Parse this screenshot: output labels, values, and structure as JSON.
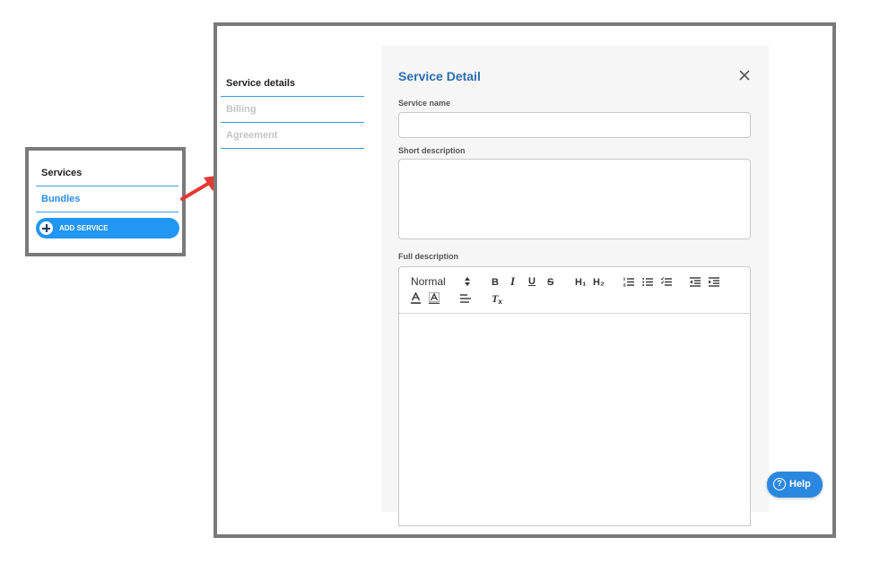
{
  "mini_sidebar": {
    "items": [
      {
        "label": "Services"
      },
      {
        "label": "Bundles"
      }
    ],
    "add_button_label": "ADD SERVICE"
  },
  "nav": {
    "items": [
      {
        "label": "Service details",
        "active": true
      },
      {
        "label": "Billing",
        "active": false
      },
      {
        "label": "Agreement",
        "active": false
      }
    ]
  },
  "panel": {
    "title": "Service Detail",
    "service_name_label": "Service name",
    "service_name_value": "",
    "short_description_label": "Short description",
    "short_description_value": "",
    "full_description_label": "Full description",
    "editor": {
      "header_select_value": "Normal",
      "toolbar": {
        "bold": "B",
        "italic": "I",
        "underline": "U",
        "strike": "S",
        "h1": "H₁",
        "h2": "H₂",
        "clean": "T"
      }
    }
  },
  "help_button": {
    "label": "Help",
    "icon_glyph": "?"
  },
  "colors": {
    "accent": "#2196f3",
    "title_blue": "#2a6cb0",
    "frame_border": "#7a7a7a",
    "arrow": "#e53935"
  },
  "icons": [
    "plus-icon",
    "close-icon",
    "help-icon",
    "arrow-annotation"
  ]
}
